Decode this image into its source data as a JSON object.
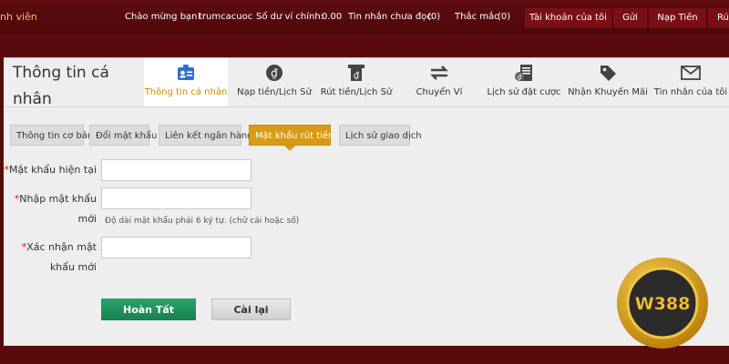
{
  "topbar": {
    "brand_partial": "nh viên",
    "welcome": "Chào mừng bạn!",
    "username": "trumcacuoc",
    "balance_label": "Số dư ví chính:",
    "balance_value": "0.00",
    "unread_label": "Tin nhắn chưa đọc",
    "unread_count": "(0)",
    "faq_label": "Thắc mắc",
    "faq_count": "(0)",
    "buttons": [
      "Tài khoản của tôi",
      "Gửi",
      "Nạp Tiền",
      "Rú"
    ]
  },
  "panel": {
    "title": "Thông tin cá nhân",
    "tabs": [
      {
        "label": "Thông tin cá nhân",
        "icon": "profile-card-icon",
        "active": true
      },
      {
        "label": "Nạp tiền/Lịch Sử",
        "icon": "coin-icon"
      },
      {
        "label": "Rút tiền/Lịch Sử",
        "icon": "atm-withdraw-icon"
      },
      {
        "label": "Chuyển Ví",
        "icon": "transfer-arrows-icon"
      },
      {
        "label": "Lịch sử đặt cược",
        "icon": "bet-history-icon"
      },
      {
        "label": "Nhận Khuyến Mãi",
        "icon": "promotion-tag-icon"
      },
      {
        "label": "Tin nhắn của tôi",
        "icon": "envelope-icon"
      }
    ],
    "subtabs": [
      {
        "label": "Thông tin cơ bản"
      },
      {
        "label": "Đổi mật khẩu"
      },
      {
        "label": "Liên kết ngân hàng"
      },
      {
        "label": "Mật khẩu rút tiền",
        "active": true
      },
      {
        "label": "Lịch sử giao dịch"
      }
    ]
  },
  "form": {
    "current_password_label": "Mật khẩu hiện tại",
    "current_password_value": "",
    "new_password_label_line1": "Nhập mật khẩu",
    "new_password_label_line2": "mới",
    "new_password_value": "",
    "new_password_hint": "Độ dài mật khẩu phải 6 ký tự. (chữ cái hoặc số)",
    "confirm_password_label_line1": "Xác nhận mật",
    "confirm_password_label_line2": "khẩu mới",
    "confirm_password_value": "",
    "required_mark": "*",
    "submit_label": "Hoàn Tất",
    "reset_label": "Cài lại"
  },
  "logo": {
    "text": "W388",
    "colors": {
      "gold": "#e0a615",
      "dark": "#2b2b2b"
    }
  },
  "colors": {
    "header_bg": "#5a0a0d",
    "accent_gold": "#d89b13",
    "submit_green": "#1f8f5c",
    "required_red": "#dd1111"
  }
}
